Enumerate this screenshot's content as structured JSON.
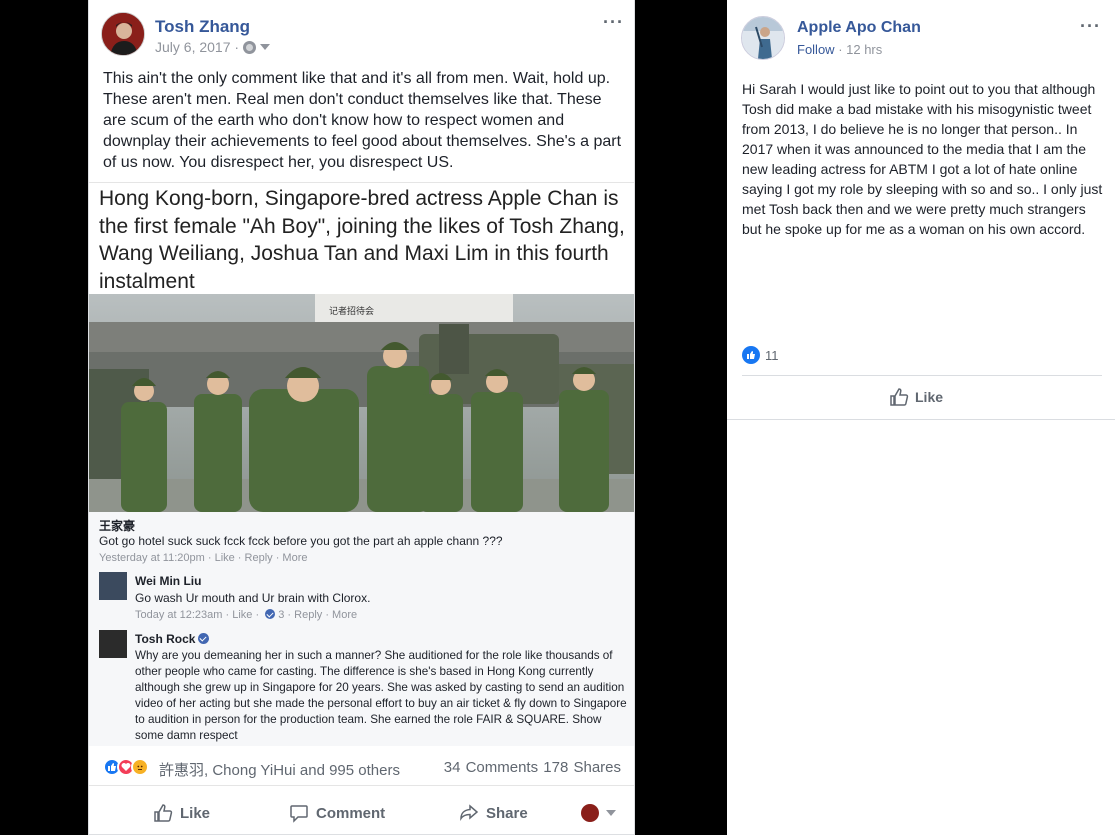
{
  "post": {
    "author": "Tosh Zhang",
    "date": "July 6, 2017 ·",
    "menu": "···",
    "text": "This ain't the only comment like that and it's all from men. Wait, hold up. These aren't men. Real men don't conduct themselves like that. These are scum of the earth who don't know how to respect women and downplay their achievements to feel good about themselves. She's a part of us now. You disrespect her, you disrespect US.",
    "embed": {
      "headline": "Hong Kong-born, Singapore-bred actress Apple Chan is the first female \"Ah Boy\", joining the likes of Tosh Zhang, Wang Weiliang, Joshua Tan and Maxi Lim in this fourth instalment",
      "banner": "记者招待会",
      "comments": [
        {
          "name": "王家豪",
          "text": "Got go hotel suck suck fcck fcck before you got the part ah apple chann ???",
          "meta": "Yesterday at 11:20pm · Like · Reply · More"
        },
        {
          "name": "Wei Min Liu",
          "text": "Go wash Ur mouth and Ur brain with Clorox.",
          "meta": "Today at 12:23am · Like · ",
          "reactions": "3",
          "meta2": " · Reply · More"
        },
        {
          "name": "Tosh Rock",
          "text": "Why are you demeaning her in such a manner? She auditioned for the role like thousands of other people who came for casting. The difference is she's based in Hong Kong currently although she grew up in Singapore for 20 years. She was asked by casting to send an audition video of her acting but she made the personal effort to buy an air ticket & fly down to Singapore to audition in person for the production team. She earned the role FAIR & SQUARE. Show some damn respect"
        }
      ]
    },
    "reaction_names": "許惠羽, Chong YiHui and 995 others",
    "counts": "34 Comments  178 Shares",
    "actions": {
      "like": "Like",
      "comment": "Comment",
      "share": "Share"
    }
  },
  "side": {
    "author": "Apple Apo Chan",
    "follow": "Follow",
    "time": " · 12 hrs",
    "menu": "···",
    "text": "Hi Sarah I would just like to point out to you that although Tosh did make a bad mistake with his misogynistic tweet from 2013, I do believe he is no longer that person.. In 2017 when it was announced to the media that I am the new leading actress for ABTM I got a lot of hate online saying I got my role by sleeping with so and so.. I only just met Tosh back then and we were pretty much strangers but he spoke up for me as a woman on his own accord.",
    "like_count": "11",
    "like_label": "Like"
  },
  "colors": {
    "link": "#365899",
    "like_blue": "#1877f2",
    "love_red": "#f33e58",
    "angry": "#f7b125"
  }
}
